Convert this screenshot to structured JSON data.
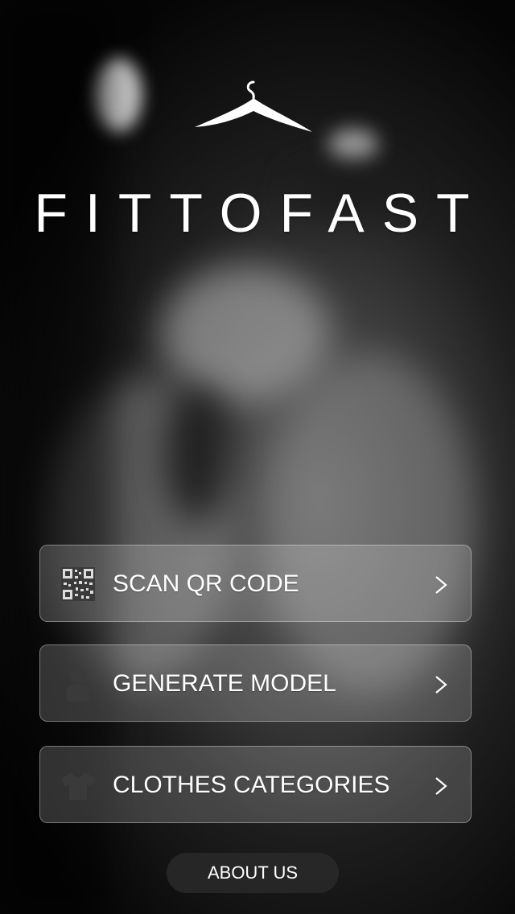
{
  "app": {
    "brand_name": "FITTOFAST",
    "logo_icon": "hanger-icon"
  },
  "menu": {
    "items": [
      {
        "label": "SCAN QR CODE",
        "icon": "qr-code-icon"
      },
      {
        "label": "GENERATE MODEL",
        "icon": "person-icon"
      },
      {
        "label": "CLOTHES CATEGORIES",
        "icon": "tshirt-icon"
      }
    ]
  },
  "footer": {
    "about_label": "ABOUT US"
  },
  "colors": {
    "text": "#ffffff",
    "button_bg": "rgba(255,255,255,0.18)",
    "about_bg": "#282828"
  }
}
